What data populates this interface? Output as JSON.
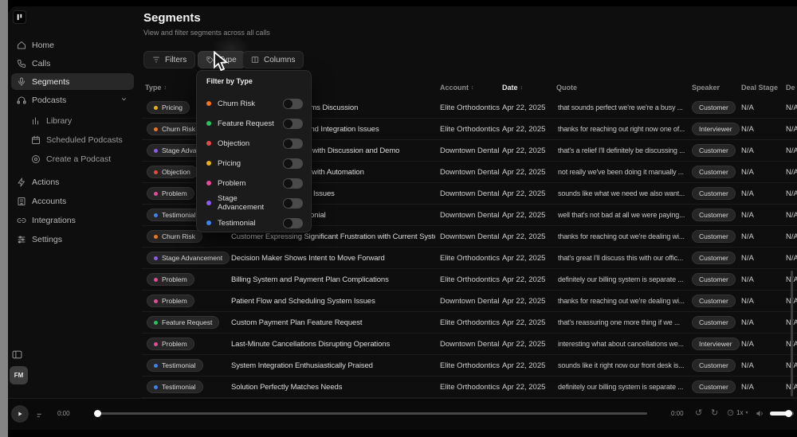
{
  "page": {
    "title": "Segments",
    "subtitle": "View and filter segments across all calls"
  },
  "sidebar": {
    "items": [
      {
        "label": "Home",
        "icon": "home-icon",
        "active": false,
        "indent": false,
        "gap": false,
        "chevron": false
      },
      {
        "label": "Calls",
        "icon": "phone-icon",
        "active": false,
        "indent": false,
        "gap": false,
        "chevron": false
      },
      {
        "label": "Segments",
        "icon": "segments-icon",
        "active": true,
        "indent": false,
        "gap": false,
        "chevron": false
      },
      {
        "label": "Podcasts",
        "icon": "podcasts-icon",
        "active": false,
        "indent": false,
        "gap": false,
        "chevron": true
      },
      {
        "label": "Library",
        "icon": "library-icon",
        "active": false,
        "indent": true,
        "gap": false,
        "chevron": false
      },
      {
        "label": "Scheduled Podcasts",
        "icon": "scheduled-icon",
        "active": false,
        "indent": true,
        "gap": false,
        "chevron": false
      },
      {
        "label": "Create a Podcast",
        "icon": "create-icon",
        "active": false,
        "indent": true,
        "gap": false,
        "chevron": false
      },
      {
        "label": "Actions",
        "icon": "actions-icon",
        "active": false,
        "indent": false,
        "gap": true,
        "chevron": false
      },
      {
        "label": "Accounts",
        "icon": "accounts-icon",
        "active": false,
        "indent": false,
        "gap": false,
        "chevron": false
      },
      {
        "label": "Integrations",
        "icon": "integrations-icon",
        "active": false,
        "indent": false,
        "gap": false,
        "chevron": false
      },
      {
        "label": "Settings",
        "icon": "settings-icon",
        "active": false,
        "indent": false,
        "gap": false,
        "chevron": false
      }
    ],
    "avatar_initials": "FM"
  },
  "toolbar": {
    "filters_label": "Filters",
    "type_label": "Type",
    "columns_label": "Columns"
  },
  "filter_dropdown": {
    "title": "Filter by Type",
    "options": [
      {
        "label": "Churn Risk",
        "color": "#f97316",
        "enabled": false
      },
      {
        "label": "Feature Request",
        "color": "#22c55e",
        "enabled": false
      },
      {
        "label": "Objection",
        "color": "#ef4444",
        "enabled": false
      },
      {
        "label": "Pricing",
        "color": "#eab308",
        "enabled": false
      },
      {
        "label": "Problem",
        "color": "#ec4899",
        "enabled": false
      },
      {
        "label": "Stage Advancement",
        "color": "#8b5cf6",
        "enabled": false
      },
      {
        "label": "Testimonial",
        "color": "#3b82f6",
        "enabled": false
      }
    ]
  },
  "table": {
    "columns": [
      {
        "label": "Type"
      },
      {
        "label": "Name"
      },
      {
        "label": "Account"
      },
      {
        "label": "Date"
      },
      {
        "label": "Quote"
      },
      {
        "label": "Speaker"
      },
      {
        "label": "Deal Stage"
      },
      {
        "label": "De"
      }
    ],
    "type_colors": {
      "Pricing": "#eab308",
      "Churn Risk": "#f97316",
      "Stage Advancement": "#8b5cf6",
      "Objection": "#ef4444",
      "Problem": "#ec4899",
      "Testimonial": "#3b82f6",
      "Feature Request": "#22c55e"
    },
    "rows": [
      {
        "type": "Pricing",
        "name": "Pricing and Contract Terms Discussion",
        "account": "Elite Orthodontics",
        "date": "Apr 22, 2025",
        "quote": "that sounds perfect we're we're a busy ...",
        "speaker": "Customer",
        "deal_stage": "N/A",
        "extra": "N/A"
      },
      {
        "type": "Churn Risk",
        "name": "Current Billing System and Integration Issues",
        "account": "Elite Orthodontics",
        "date": "Apr 22, 2025",
        "quote": "thanks for reaching out right now one of...",
        "speaker": "Interviewer",
        "deal_stage": "N/A",
        "extra": "N/A"
      },
      {
        "type": "Stage Advancement",
        "name": "Ready to Move Forward with Discussion and Demo",
        "account": "Downtown Dental",
        "date": "Apr 22, 2025",
        "quote": "that's a relief I'll definitely be discussing ...",
        "speaker": "Customer",
        "deal_stage": "N/A",
        "extra": "N/A"
      },
      {
        "type": "Objection",
        "name": "Concerns About Control with Automation",
        "account": "Downtown Dental",
        "date": "Apr 22, 2025",
        "quote": "not really we've been doing it manually ...",
        "speaker": "Customer",
        "deal_stage": "N/A",
        "extra": "N/A"
      },
      {
        "type": "Problem",
        "name": "Scheduling Walkthrough Issues",
        "account": "Downtown Dental",
        "date": "Apr 22, 2025",
        "quote": "sounds like what we need we also want...",
        "speaker": "Customer",
        "deal_stage": "N/A",
        "extra": "N/A"
      },
      {
        "type": "Testimonial",
        "name": "Happy Customer Testimonial",
        "account": "Downtown Dental",
        "date": "Apr 22, 2025",
        "quote": "well that's not bad at all we were paying...",
        "speaker": "Customer",
        "deal_stage": "N/A",
        "extra": "N/A"
      },
      {
        "type": "Churn Risk",
        "name": "Customer Expressing Significant Frustration with Current System",
        "account": "Downtown Dental",
        "date": "Apr 22, 2025",
        "quote": "thanks for reaching out we're dealing wi...",
        "speaker": "Customer",
        "deal_stage": "N/A",
        "extra": "N/A"
      },
      {
        "type": "Stage Advancement",
        "name": "Decision Maker Shows Intent to Move Forward",
        "account": "Elite Orthodontics",
        "date": "Apr 22, 2025",
        "quote": "that's great I'll discuss this with our offic...",
        "speaker": "Customer",
        "deal_stage": "N/A",
        "extra": "N/A"
      },
      {
        "type": "Problem",
        "name": "Billing System and Payment Plan Complications",
        "account": "Elite Orthodontics",
        "date": "Apr 22, 2025",
        "quote": "definitely our billing system is separate ...",
        "speaker": "Customer",
        "deal_stage": "N/A",
        "extra": "N/A"
      },
      {
        "type": "Problem",
        "name": "Patient Flow and Scheduling System Issues",
        "account": "Downtown Dental",
        "date": "Apr 22, 2025",
        "quote": "thanks for reaching out we're dealing wi...",
        "speaker": "Customer",
        "deal_stage": "N/A",
        "extra": "N/A"
      },
      {
        "type": "Feature Request",
        "name": "Custom Payment Plan Feature Request",
        "account": "Elite Orthodontics",
        "date": "Apr 22, 2025",
        "quote": "that's reassuring one more thing if we ...",
        "speaker": "Customer",
        "deal_stage": "N/A",
        "extra": "N/A"
      },
      {
        "type": "Problem",
        "name": "Last-Minute Cancellations Disrupting Operations",
        "account": "Downtown Dental",
        "date": "Apr 22, 2025",
        "quote": "interesting what about cancellations we...",
        "speaker": "Interviewer",
        "deal_stage": "N/A",
        "extra": "N/A"
      },
      {
        "type": "Testimonial",
        "name": "System Integration Enthusiastically Praised",
        "account": "Elite Orthodontics",
        "date": "Apr 22, 2025",
        "quote": "sounds like it right now our front desk is...",
        "speaker": "Customer",
        "deal_stage": "N/A",
        "extra": "N/A"
      },
      {
        "type": "Testimonial",
        "name": "Solution Perfectly Matches Needs",
        "account": "Elite Orthodontics",
        "date": "Apr 22, 2025",
        "quote": "definitely our billing system is separate ...",
        "speaker": "Customer",
        "deal_stage": "N/A",
        "extra": "N/A"
      }
    ]
  },
  "player": {
    "elapsed": "0:00",
    "remaining": "0:00",
    "speed": "1x"
  }
}
